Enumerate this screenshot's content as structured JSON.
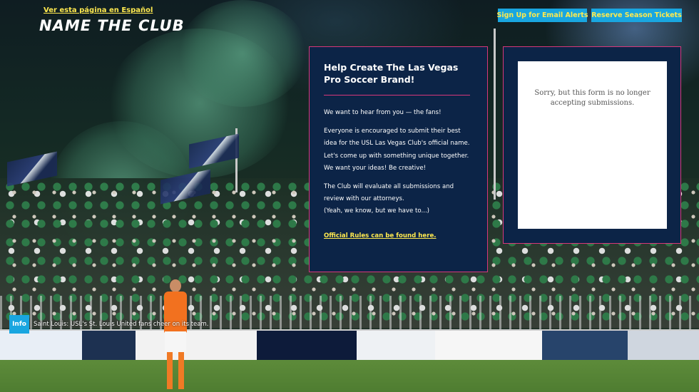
{
  "header": {
    "language_link": "Ver esta página en Español",
    "logo_text": "NAME THE CLUB",
    "buttons": {
      "email_alerts": "Sign Up for Email Alerts",
      "season_tickets": "Reserve Season Tickets"
    }
  },
  "info_panel": {
    "title": "Help Create The Las Vegas Pro Soccer Brand!",
    "paragraphs": [
      "We want to hear from you — the fans!",
      "Everyone is encouraged to submit their best idea for the USL Las Vegas Club's official name. Let's come up with something unique together. We want your ideas! Be creative!",
      "The Club will evaluate all submissions and review with our attorneys.",
      "(Yeah, we know, but we have to...)"
    ],
    "rules_link": "Official Rules can be found here."
  },
  "form_panel": {
    "message": "Sorry, but this form is no longer accepting submissions."
  },
  "photo_caption": {
    "badge": "Info",
    "text": "Saint Louis: USL's St. Louis United fans cheer on its team."
  },
  "colors": {
    "panel_bg": "#0c2447",
    "panel_border": "#d8377a",
    "accent_button": "#19a6e0",
    "link_yellow": "#ffe94f"
  }
}
